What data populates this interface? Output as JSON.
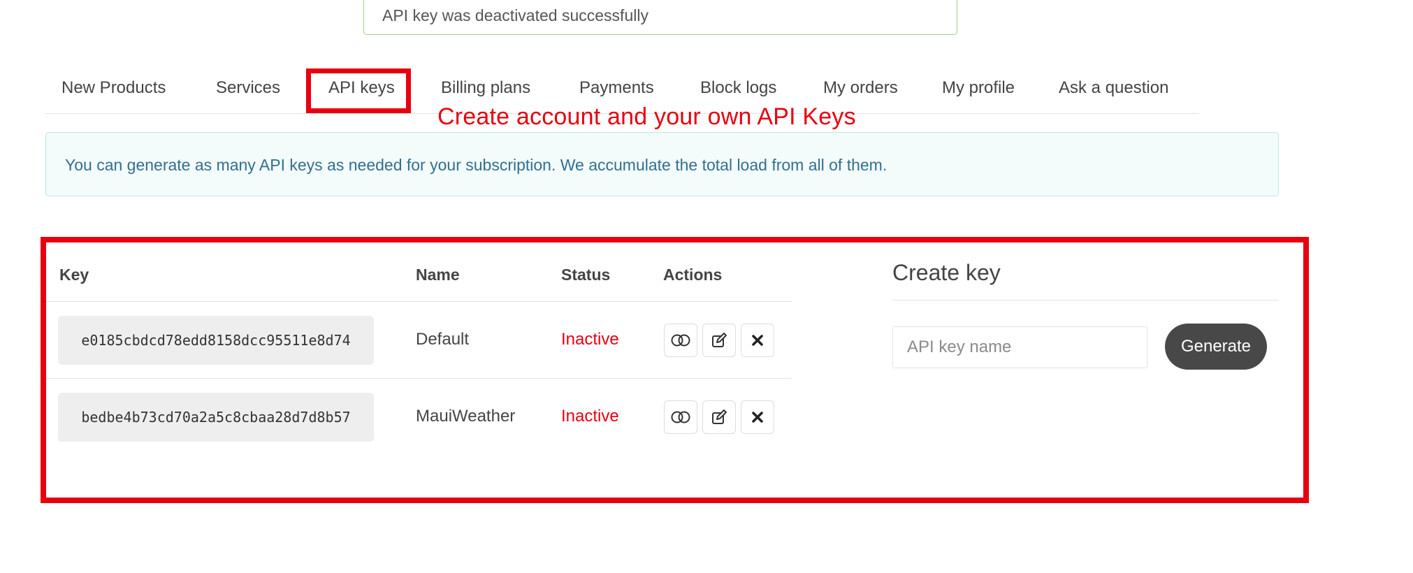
{
  "notice": {
    "text": "API key was deactivated successfully",
    "border_color": "#a6cf8a"
  },
  "tabs": [
    {
      "label": "New Products"
    },
    {
      "label": "Services"
    },
    {
      "label": "API keys",
      "active": true
    },
    {
      "label": "Billing plans"
    },
    {
      "label": "Payments"
    },
    {
      "label": "Block logs"
    },
    {
      "label": "My orders"
    },
    {
      "label": "My profile"
    },
    {
      "label": "Ask a question"
    }
  ],
  "annotation": {
    "text": "Create account and your own API Keys",
    "color": "#e8000f"
  },
  "info": {
    "text": "You can generate as many API keys as needed for your subscription. We accumulate the total load from all of them.",
    "text_color": "#31708f",
    "background": "#f3fbfb"
  },
  "table": {
    "headers": {
      "key": "Key",
      "name": "Name",
      "status": "Status",
      "actions": "Actions"
    },
    "rows": [
      {
        "key": "e0185cbdcd78edd8158dcc95511e8d74",
        "name": "Default",
        "status": "Inactive"
      },
      {
        "key": "bedbe4b73cd70a2a5c8cbaa28d7d8b57",
        "name": "MauiWeather",
        "status": "Inactive"
      }
    ],
    "action_icons": [
      "toggle-icon",
      "edit-icon",
      "delete-icon"
    ],
    "status_color": "#e8000f"
  },
  "create_key": {
    "title": "Create key",
    "input_placeholder": "API key name",
    "input_value": "",
    "generate_label": "Generate",
    "button_color": "#484848"
  }
}
